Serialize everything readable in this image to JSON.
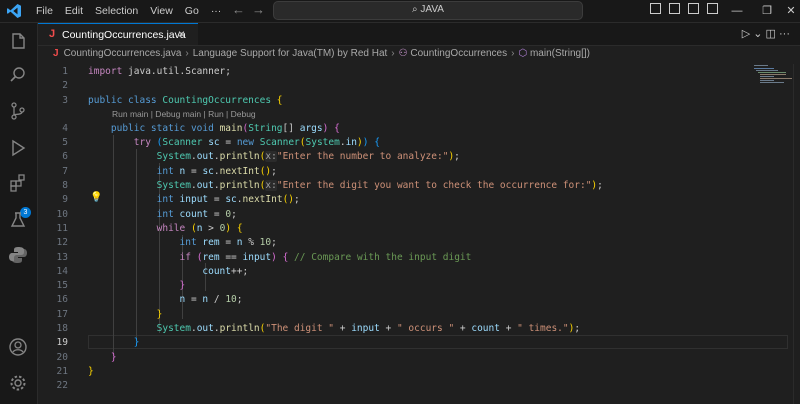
{
  "menu": [
    "File",
    "Edit",
    "Selection",
    "View",
    "Go",
    "···"
  ],
  "search": {
    "label": "JAVA"
  },
  "tab": {
    "icon": "J",
    "label": "CountingOccurrences.java",
    "close": "×"
  },
  "editor_actions": "▷ ⌄ ◫ ···",
  "breadcrumb": {
    "icon": "J",
    "file": "CountingOccurrences.java",
    "part1": "Language Support for Java(TM) by Red Hat",
    "class": "CountingOccurrences",
    "method": "main(String[])"
  },
  "codelens": "Run main | Debug main | Run | Debug",
  "line_numbers": [
    "1",
    "2",
    "3",
    "4",
    "5",
    "6",
    "7",
    "8",
    "9",
    "10",
    "11",
    "12",
    "13",
    "14",
    "15",
    "16",
    "17",
    "18",
    "19",
    "20",
    "21",
    "22"
  ],
  "active_line": "19",
  "code": {
    "l1_kw": "import",
    "l1_rest": " java.util.Scanner;",
    "l3_kw": "public class",
    "l3_cls": "CountingOccurrences",
    "l3_b": "{",
    "l4_kw1": "public static void",
    "l4_fn": "main",
    "l4_ty": "String",
    "l4_arr": "[]",
    "l4_var": "args",
    "l4_b": "{",
    "l5_kw": "try",
    "l5_ty": "Scanner",
    "l5_var": "sc",
    "l5_new": "new",
    "l5_ty2": "Scanner",
    "l5_sys": "System",
    "l5_in": "in",
    "l5_b": "{",
    "l6_sys": "System",
    "l6_out": "out",
    "l6_fn": "println",
    "l6_hint": "x:",
    "l6_str": "\"Enter the number to analyze:\"",
    "l7_kw": "int",
    "l7_var": "n",
    "l7_sc": "sc",
    "l7_fn": "nextInt",
    "l8_sys": "System",
    "l8_out": "out",
    "l8_fn": "println",
    "l8_hint": "x:",
    "l8_str": "\"Enter the digit you want to check the occurrence for:\"",
    "l9_kw": "int",
    "l9_var": "input",
    "l9_sc": "sc",
    "l9_fn": "nextInt",
    "l10_kw": "int",
    "l10_var": "count",
    "l10_num": "0",
    "l11_kw": "while",
    "l11_var": "n",
    "l11_num": "0",
    "l12_kw": "int",
    "l12_var": "rem",
    "l12_n": "n",
    "l12_num": "10",
    "l13_kw": "if",
    "l13_rem": "rem",
    "l13_input": "input",
    "l13_cm": "// Compare with the input digit",
    "l14_var": "count",
    "l16_n": "n",
    "l16_n2": "n",
    "l16_num": "10",
    "l18_sys": "System",
    "l18_out": "out",
    "l18_fn": "println",
    "l18_s1": "\"The digit \"",
    "l18_input": "input",
    "l18_s2": "\" occurs \"",
    "l18_count": "count",
    "l18_s3": "\" times.\""
  }
}
